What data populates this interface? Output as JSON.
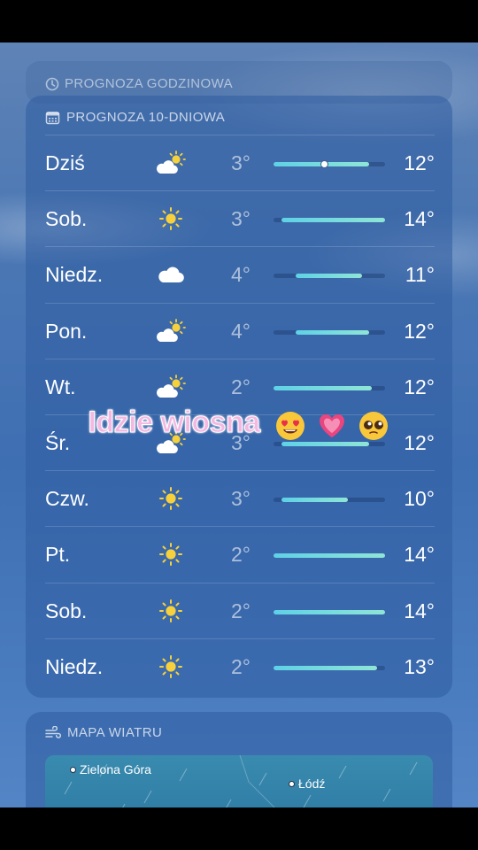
{
  "hourly": {
    "title": "PROGNOZA GODZINOWA",
    "icon": "clock-icon"
  },
  "forecast": {
    "title": "PROGNOZA 10-DNIOWA",
    "icon": "calendar-icon",
    "days": [
      {
        "day": "Dziś",
        "icon": "partly-sunny-icon",
        "lo": "3°",
        "hi": "12°",
        "bar": [
          0.0,
          0.86
        ],
        "current": 0.46
      },
      {
        "day": "Sob.",
        "icon": "sun-icon",
        "lo": "3°",
        "hi": "14°",
        "bar": [
          0.07,
          1.0
        ]
      },
      {
        "day": "Niedz.",
        "icon": "cloud-icon",
        "lo": "4°",
        "hi": "11°",
        "bar": [
          0.2,
          0.79
        ]
      },
      {
        "day": "Pon.",
        "icon": "partly-sunny-icon",
        "lo": "4°",
        "hi": "12°",
        "bar": [
          0.2,
          0.86
        ]
      },
      {
        "day": "Wt.",
        "icon": "partly-sunny-icon",
        "lo": "2°",
        "hi": "12°",
        "bar": [
          0.0,
          0.88
        ]
      },
      {
        "day": "Śr.",
        "icon": "partly-sunny-icon",
        "lo": "3°",
        "hi": "12°",
        "bar": [
          0.07,
          0.86
        ]
      },
      {
        "day": "Czw.",
        "icon": "sun-icon",
        "lo": "3°",
        "hi": "10°",
        "bar": [
          0.07,
          0.67
        ]
      },
      {
        "day": "Pt.",
        "icon": "sun-icon",
        "lo": "2°",
        "hi": "14°",
        "bar": [
          0.0,
          1.0
        ]
      },
      {
        "day": "Sob.",
        "icon": "sun-icon",
        "lo": "2°",
        "hi": "14°",
        "bar": [
          0.0,
          1.0
        ]
      },
      {
        "day": "Niedz.",
        "icon": "sun-icon",
        "lo": "2°",
        "hi": "13°",
        "bar": [
          0.0,
          0.93
        ]
      }
    ]
  },
  "overlay": {
    "text": "Idzie wiosna",
    "emojis": [
      "heart-eyes-emoji",
      "pink-heart-emoji",
      "pleading-face-emoji"
    ]
  },
  "wind": {
    "title": "MAPA WIATRU",
    "icon": "wind-icon",
    "cities": [
      "Zielona Góra",
      "Łódź"
    ]
  },
  "colors": {
    "bar_start": "#5fd1e6",
    "bar_end": "#8fe5d6",
    "overlay_text": "#f4b8e2",
    "sun": "#f7d13b"
  }
}
